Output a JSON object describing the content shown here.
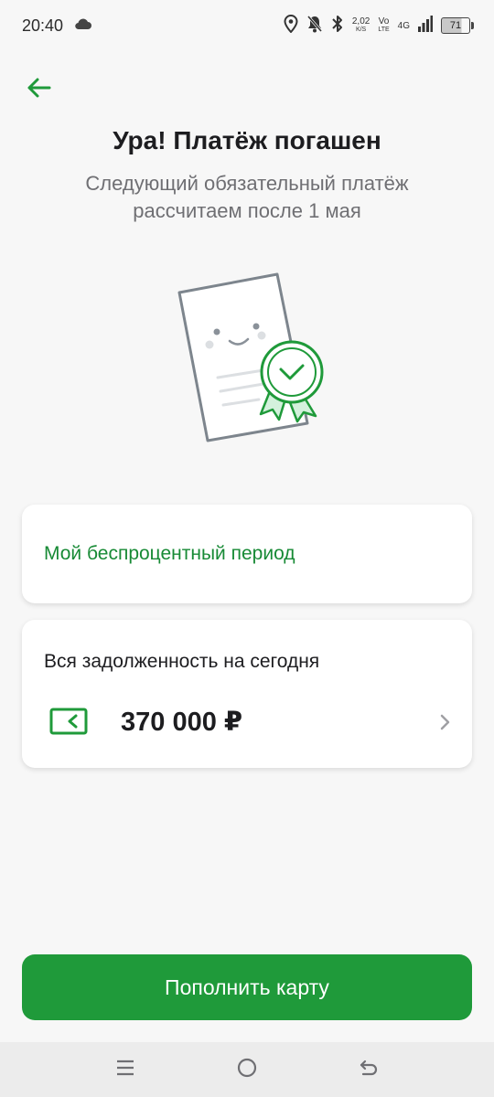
{
  "status_bar": {
    "time": "20:40",
    "net_speed_value": "2,02",
    "net_speed_unit": "K/S",
    "volte_top": "Vo",
    "volte_bottom": "LTE",
    "network_type": "4G",
    "battery_level": "71",
    "icons": [
      "cloud-icon",
      "location-icon",
      "bell-off-icon",
      "bluetooth-icon",
      "signal-icon",
      "battery-icon"
    ]
  },
  "header": {
    "back_icon": "arrow-left-icon",
    "title": "Ура! Платёж погашен",
    "subtitle": "Следующий обязательный платёж рассчитаем после 1 мая"
  },
  "illustration": {
    "icon": "document-with-award-icon"
  },
  "cards": {
    "interest_free_period": {
      "label": "Мой беспроцентный период"
    },
    "total_debt": {
      "label": "Вся задолженность на сегодня",
      "amount": "370 000 ₽",
      "icon": "card-wallet-icon",
      "chevron": "chevron-right-icon"
    }
  },
  "actions": {
    "top_up_label": "Пополнить карту"
  },
  "nav_bar": {
    "icons": [
      "menu-icon",
      "home-icon",
      "back-icon"
    ]
  },
  "colors": {
    "accent_green": "#1f9a3a",
    "link_green": "#178a35",
    "background": "#f7f7f7",
    "text_primary": "#1d1d20",
    "text_secondary": "#6f6f73"
  }
}
